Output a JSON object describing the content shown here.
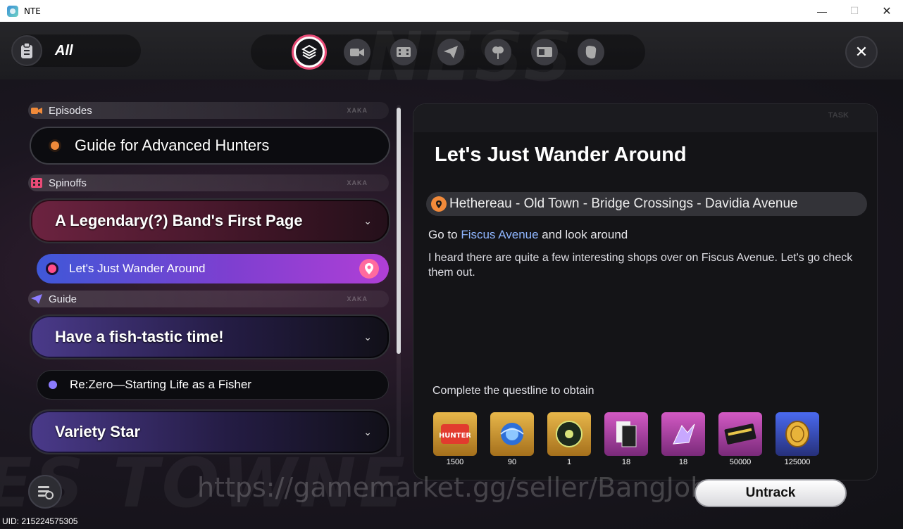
{
  "window": {
    "title": "NTE",
    "minimize_glyph": "—",
    "maximize_glyph": "☐",
    "close_glyph": "✕"
  },
  "header": {
    "filter_label": "All",
    "filter_icon": "clipboard-icon",
    "tabs": [
      {
        "icon": "layers-icon",
        "active": true
      },
      {
        "icon": "camera-icon",
        "active": false
      },
      {
        "icon": "film-icon",
        "active": false
      },
      {
        "icon": "paper-plane-icon",
        "active": false
      },
      {
        "icon": "flower-icon",
        "active": false
      },
      {
        "icon": "ticket-icon",
        "active": false
      },
      {
        "icon": "fist-icon",
        "active": false
      }
    ],
    "close_glyph": "✕"
  },
  "quest_list": {
    "sections": [
      {
        "name": "Episodes",
        "tag": "XAKA"
      },
      {
        "name": "Spinoffs",
        "tag": "XAKA"
      },
      {
        "name": "Guide",
        "tag": "XAKA"
      }
    ],
    "episode_quest": "Guide for Advanced Hunters",
    "spinoff_questline": "A Legendary(?) Band's First Page",
    "spinoff_active_quest": "Let's Just Wander Around",
    "guide_questline_1": "Have a fish-tastic time!",
    "guide_sub_quest": "Re:Zero—Starting Life as a Fisher",
    "guide_questline_2": "Variety Star",
    "chevron_glyph": "⌄"
  },
  "detail": {
    "tag": "TASK",
    "title": "Let's Just Wander Around",
    "location": "Hethereau - Old Town - Bridge Crossings - Davidia Avenue",
    "objective_prefix": "Go to ",
    "objective_highlight": "Fiscus Avenue",
    "objective_suffix": " and look around",
    "description": "I heard there are quite a few interesting shops over on Fiscus Avenue. Let's go check them out.",
    "reward_label": "Complete the questline to obtain",
    "rewards": [
      {
        "count": "1500",
        "color": "#d9a232"
      },
      {
        "count": "90",
        "color": "#d9a232"
      },
      {
        "count": "1",
        "color": "#d9a232"
      },
      {
        "count": "18",
        "color": "#c04bb0"
      },
      {
        "count": "18",
        "color": "#c04bb0"
      },
      {
        "count": "50000",
        "color": "#c04bb0"
      },
      {
        "count": "125000",
        "color": "#3f5fd8"
      }
    ]
  },
  "footer": {
    "uid": "UID: 215224575305",
    "watermark": "https://gamemarket.gg/seller/BangJohn",
    "untrack_label": "Untrack"
  },
  "colors": {
    "accent_pink": "#e94b77",
    "active_gradient_start": "#3f58d8",
    "active_gradient_end": "#b03fd6",
    "highlight_blue": "#8fb6ff"
  }
}
